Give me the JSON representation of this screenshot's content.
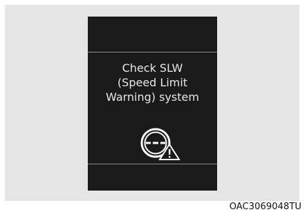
{
  "display": {
    "message_lines": [
      "Check SLW",
      "(Speed Limit",
      "Warning) system"
    ],
    "icon": "speed-limit-warning-icon",
    "colors": {
      "background": "#1a1a1a",
      "text": "#e8e8e8",
      "icon": "#ffffff"
    }
  },
  "figure_code": "OAC3069048TU"
}
